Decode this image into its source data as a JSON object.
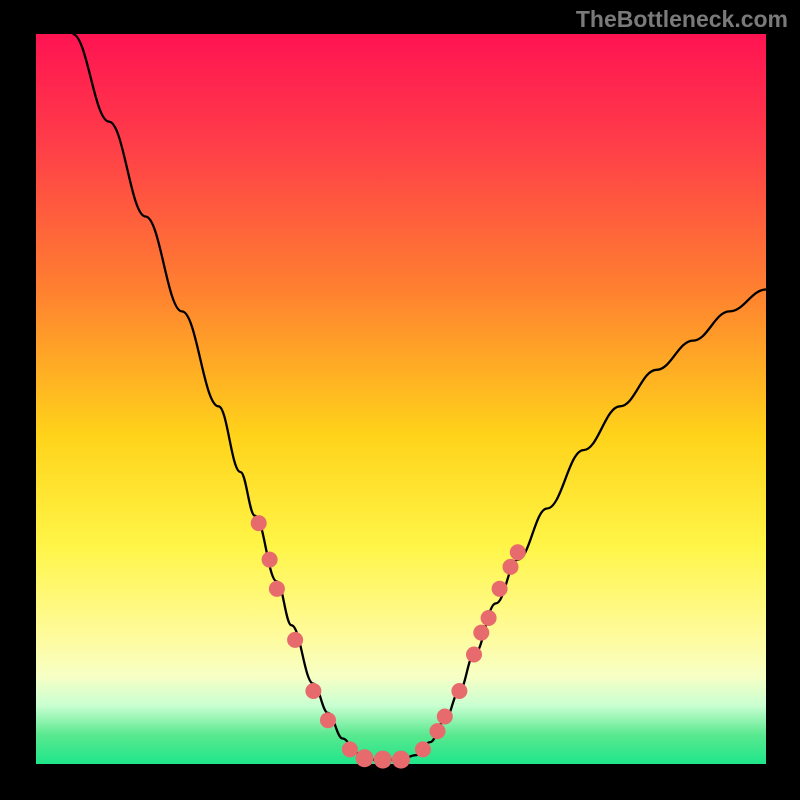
{
  "chart_data": {
    "type": "line",
    "watermark": "TheBottleneck.com",
    "xlim": [
      0,
      100
    ],
    "ylim": [
      0,
      100
    ],
    "curve": [
      {
        "x": 5,
        "y": 100
      },
      {
        "x": 10,
        "y": 88
      },
      {
        "x": 15,
        "y": 75
      },
      {
        "x": 20,
        "y": 62
      },
      {
        "x": 25,
        "y": 49
      },
      {
        "x": 28,
        "y": 40
      },
      {
        "x": 30,
        "y": 34
      },
      {
        "x": 33,
        "y": 25
      },
      {
        "x": 35,
        "y": 19
      },
      {
        "x": 38,
        "y": 11
      },
      {
        "x": 40,
        "y": 7
      },
      {
        "x": 42,
        "y": 3.5
      },
      {
        "x": 44,
        "y": 1.5
      },
      {
        "x": 46,
        "y": 0.6
      },
      {
        "x": 48,
        "y": 0.6
      },
      {
        "x": 50,
        "y": 0.6
      },
      {
        "x": 52,
        "y": 1.2
      },
      {
        "x": 54,
        "y": 3
      },
      {
        "x": 56,
        "y": 6
      },
      {
        "x": 58,
        "y": 10
      },
      {
        "x": 60,
        "y": 15
      },
      {
        "x": 63,
        "y": 22
      },
      {
        "x": 66,
        "y": 28
      },
      {
        "x": 70,
        "y": 35
      },
      {
        "x": 75,
        "y": 43
      },
      {
        "x": 80,
        "y": 49
      },
      {
        "x": 85,
        "y": 54
      },
      {
        "x": 90,
        "y": 58
      },
      {
        "x": 95,
        "y": 62
      },
      {
        "x": 100,
        "y": 65
      }
    ],
    "points": [
      {
        "x": 30.5,
        "y": 33,
        "r": 8
      },
      {
        "x": 32,
        "y": 28,
        "r": 8
      },
      {
        "x": 33,
        "y": 24,
        "r": 8
      },
      {
        "x": 35.5,
        "y": 17,
        "r": 8
      },
      {
        "x": 38,
        "y": 10,
        "r": 8
      },
      {
        "x": 40,
        "y": 6,
        "r": 8
      },
      {
        "x": 43,
        "y": 2,
        "r": 8
      },
      {
        "x": 45,
        "y": 0.8,
        "r": 9
      },
      {
        "x": 47.5,
        "y": 0.6,
        "r": 9
      },
      {
        "x": 50,
        "y": 0.6,
        "r": 9
      },
      {
        "x": 53,
        "y": 2,
        "r": 8
      },
      {
        "x": 55,
        "y": 4.5,
        "r": 8
      },
      {
        "x": 56,
        "y": 6.5,
        "r": 8
      },
      {
        "x": 58,
        "y": 10,
        "r": 8
      },
      {
        "x": 60,
        "y": 15,
        "r": 8
      },
      {
        "x": 61,
        "y": 18,
        "r": 8
      },
      {
        "x": 62,
        "y": 20,
        "r": 8
      },
      {
        "x": 63.5,
        "y": 24,
        "r": 8
      },
      {
        "x": 65,
        "y": 27,
        "r": 8
      },
      {
        "x": 66,
        "y": 29,
        "r": 8
      }
    ],
    "colors": {
      "dot": "#e76a6d",
      "line": "#000000",
      "gradient_top": "#ff1352",
      "gradient_bottom": "#1fe68a"
    }
  }
}
